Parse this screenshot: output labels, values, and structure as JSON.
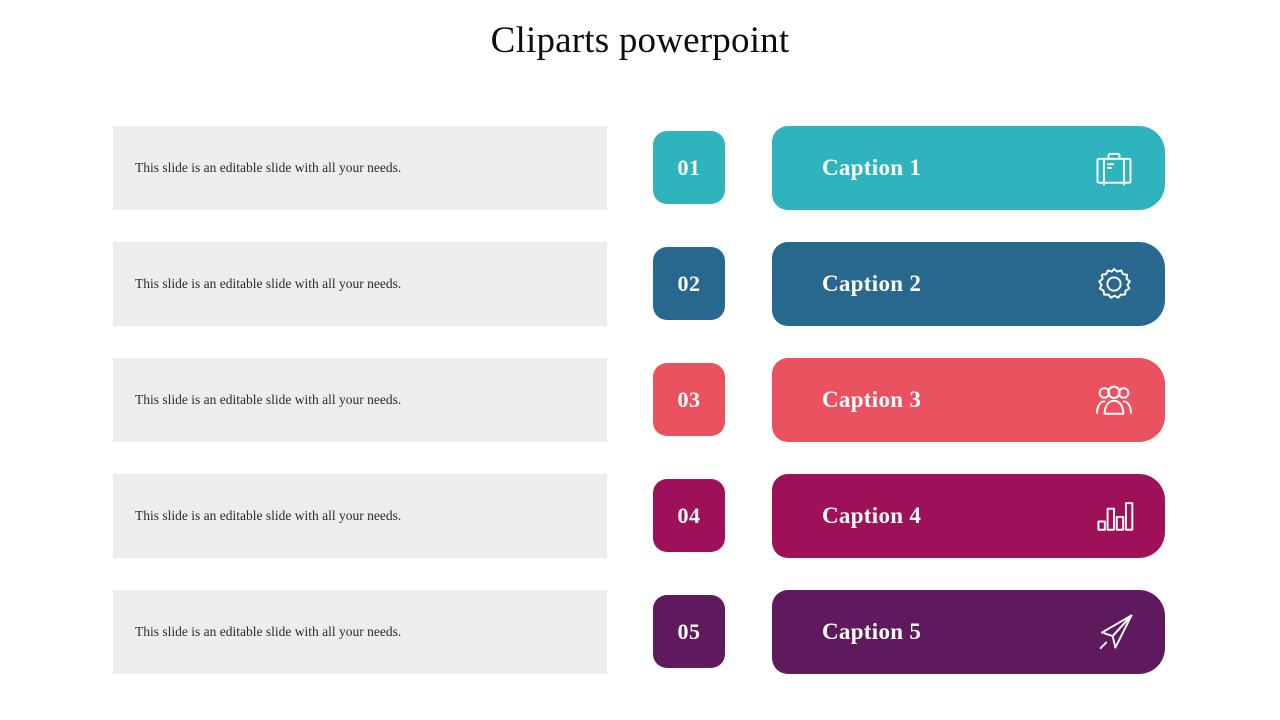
{
  "slide": {
    "title": "Cliparts powerpoint",
    "background_color": "#FFFFFF",
    "title_color": "#0D0D0D"
  },
  "description_block": {
    "background_color": "#EDEDED",
    "text_color": "#2B2B2B"
  },
  "rows": [
    {
      "number": "01",
      "description": "This slide is an editable slide with all your needs.",
      "caption": "Caption 1",
      "color": "#2FB3BC",
      "icon": "briefcase-icon"
    },
    {
      "number": "02",
      "description": "This slide is an editable slide with all your needs.",
      "caption": "Caption 2",
      "color": "#28688F",
      "icon": "gear-icon"
    },
    {
      "number": "03",
      "description": "This slide is an editable slide with all your needs.",
      "caption": "Caption 3",
      "color": "#EA5260",
      "icon": "users-group-icon"
    },
    {
      "number": "04",
      "description": "This slide is an editable slide with all your needs.",
      "caption": "Caption 4",
      "color": "#9E1159",
      "icon": "bar-chart-icon"
    },
    {
      "number": "05",
      "description": "This slide is an editable slide with all your needs.",
      "caption": "Caption 5",
      "color": "#5E1A5C",
      "icon": "paper-plane-icon"
    }
  ]
}
